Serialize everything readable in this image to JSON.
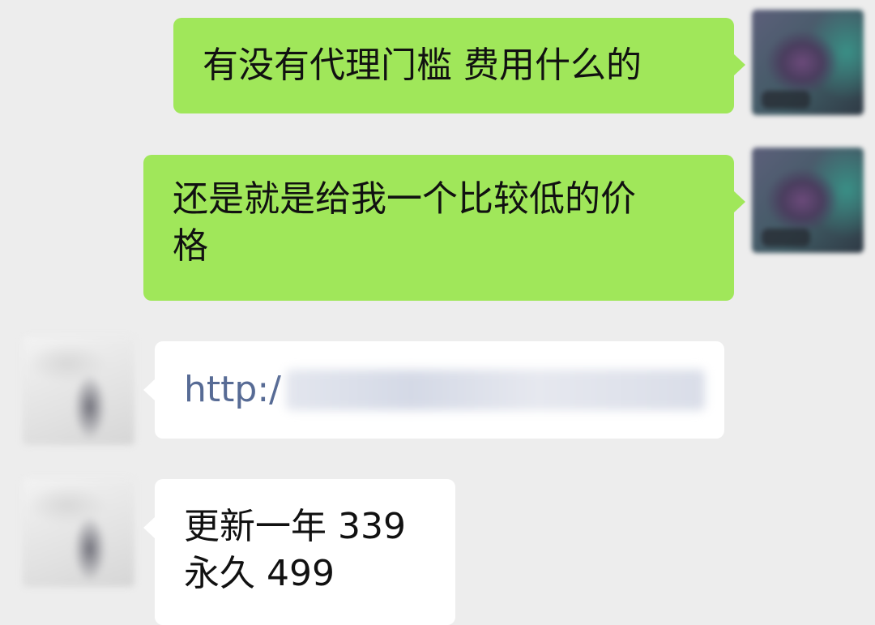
{
  "messages": [
    {
      "sender": "me",
      "text": "有没有代理门槛 费用什么的"
    },
    {
      "sender": "me",
      "text": "还是就是给我一个比较低的价\n格"
    },
    {
      "sender": "other",
      "type": "link",
      "text": "http:/"
    },
    {
      "sender": "other",
      "text": "更新一年 339\n永久 499"
    }
  ],
  "colors": {
    "background": "#ededed",
    "my_bubble": "#a0e75a",
    "other_bubble": "#ffffff",
    "link": "#576b95"
  }
}
